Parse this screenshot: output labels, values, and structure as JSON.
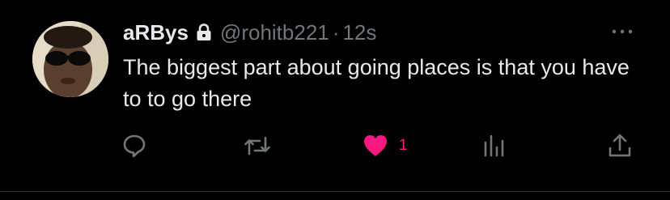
{
  "tweet": {
    "display_name": "aRBys",
    "handle": "@rohitb221",
    "separator": "·",
    "timestamp": "12s",
    "text": "The biggest part about going places is that you have to to go there",
    "like_count": "1",
    "locked": true
  },
  "icons": {
    "lock": "lock-icon",
    "more": "more-options-icon",
    "reply": "reply-icon",
    "retweet": "retweet-icon",
    "like": "heart-icon",
    "views": "views-icon",
    "share": "share-icon"
  },
  "colors": {
    "background": "#000000",
    "primary_text": "#e7e9ea",
    "secondary_text": "#71767b",
    "like_active": "#f91880",
    "divider": "#2f3336"
  }
}
